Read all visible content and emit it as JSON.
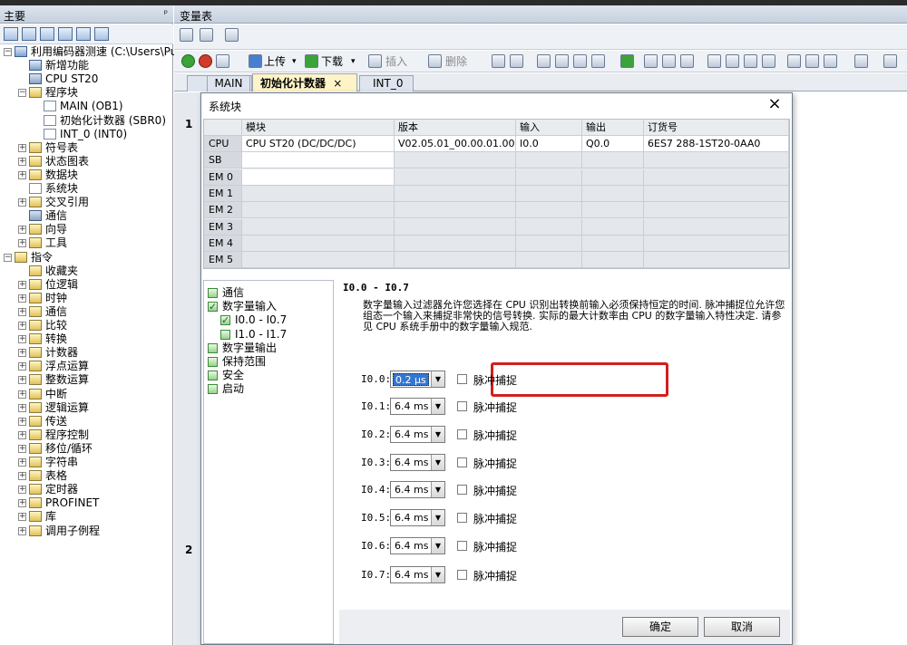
{
  "left_panel": {
    "title": "主要",
    "pin": "ᵖ",
    "tree": [
      {
        "label": "利用编码器测速 (C:\\Users\\Publi",
        "indent": 0,
        "exp": "-",
        "icon": "project"
      },
      {
        "label": "新增功能",
        "indent": 1,
        "icon": "help"
      },
      {
        "label": "CPU ST20",
        "indent": 1,
        "icon": "cpu"
      },
      {
        "label": "程序块",
        "indent": 1,
        "exp": "-",
        "icon": "folder"
      },
      {
        "label": "MAIN (OB1)",
        "indent": 2,
        "icon": "doc"
      },
      {
        "label": "初始化计数器 (SBR0)",
        "indent": 2,
        "icon": "doc"
      },
      {
        "label": "INT_0 (INT0)",
        "indent": 2,
        "icon": "doc"
      },
      {
        "label": "符号表",
        "indent": 1,
        "exp": "+",
        "icon": "folder"
      },
      {
        "label": "状态图表",
        "indent": 1,
        "exp": "+",
        "icon": "folder"
      },
      {
        "label": "数据块",
        "indent": 1,
        "exp": "+",
        "icon": "folder"
      },
      {
        "label": "系统块",
        "indent": 1,
        "icon": "doc"
      },
      {
        "label": "交叉引用",
        "indent": 1,
        "exp": "+",
        "icon": "folder"
      },
      {
        "label": "通信",
        "indent": 1,
        "icon": "cpu"
      },
      {
        "label": "向导",
        "indent": 1,
        "exp": "+",
        "icon": "folder"
      },
      {
        "label": "工具",
        "indent": 1,
        "exp": "+",
        "icon": "folder"
      },
      {
        "label": "指令",
        "indent": 0,
        "exp": "-",
        "icon": "folder"
      },
      {
        "label": "收藏夹",
        "indent": 1,
        "icon": "folder"
      },
      {
        "label": "位逻辑",
        "indent": 1,
        "exp": "+",
        "icon": "folder"
      },
      {
        "label": "时钟",
        "indent": 1,
        "exp": "+",
        "icon": "folder"
      },
      {
        "label": "通信",
        "indent": 1,
        "exp": "+",
        "icon": "folder"
      },
      {
        "label": "比较",
        "indent": 1,
        "exp": "+",
        "icon": "folder"
      },
      {
        "label": "转换",
        "indent": 1,
        "exp": "+",
        "icon": "folder"
      },
      {
        "label": "计数器",
        "indent": 1,
        "exp": "+",
        "icon": "folder"
      },
      {
        "label": "浮点运算",
        "indent": 1,
        "exp": "+",
        "icon": "folder"
      },
      {
        "label": "整数运算",
        "indent": 1,
        "exp": "+",
        "icon": "folder"
      },
      {
        "label": "中断",
        "indent": 1,
        "exp": "+",
        "icon": "folder"
      },
      {
        "label": "逻辑运算",
        "indent": 1,
        "exp": "+",
        "icon": "folder"
      },
      {
        "label": "传送",
        "indent": 1,
        "exp": "+",
        "icon": "folder"
      },
      {
        "label": "程序控制",
        "indent": 1,
        "exp": "+",
        "icon": "folder"
      },
      {
        "label": "移位/循环",
        "indent": 1,
        "exp": "+",
        "icon": "folder"
      },
      {
        "label": "字符串",
        "indent": 1,
        "exp": "+",
        "icon": "folder"
      },
      {
        "label": "表格",
        "indent": 1,
        "exp": "+",
        "icon": "folder"
      },
      {
        "label": "定时器",
        "indent": 1,
        "exp": "+",
        "icon": "folder"
      },
      {
        "label": "PROFINET",
        "indent": 1,
        "exp": "+",
        "icon": "folder"
      },
      {
        "label": "库",
        "indent": 1,
        "exp": "+",
        "icon": "folder"
      },
      {
        "label": "调用子例程",
        "indent": 1,
        "exp": "+",
        "icon": "folder"
      }
    ]
  },
  "right": {
    "title": "变量表",
    "toolbar": {
      "upload": "上传",
      "download": "下载",
      "insert": "插入",
      "delete": "删除"
    },
    "tabs": [
      "MAIN",
      "初始化计数器",
      "INT_0"
    ],
    "active_tab_close": "×",
    "network_numbers": [
      "1",
      "2"
    ]
  },
  "dialog": {
    "title": "系统块",
    "close": "×",
    "headers": [
      "模块",
      "版本",
      "输入",
      "输出",
      "订货号"
    ],
    "rows": [
      {
        "slot": "CPU",
        "module": "CPU ST20 (DC/DC/DC)",
        "version": "V02.05.01_00.00.01.00",
        "input": "I0.0",
        "output": "Q0.0",
        "order": "6ES7 288-1ST20-0AA0"
      },
      {
        "slot": "SB",
        "module": "",
        "version": "",
        "input": "",
        "output": "",
        "order": ""
      },
      {
        "slot": "EM 0",
        "module": "",
        "version": "",
        "input": "",
        "output": "",
        "order": ""
      },
      {
        "slot": "EM 1",
        "module": "",
        "version": "",
        "input": "",
        "output": "",
        "order": ""
      },
      {
        "slot": "EM 2",
        "module": "",
        "version": "",
        "input": "",
        "output": "",
        "order": ""
      },
      {
        "slot": "EM 3",
        "module": "",
        "version": "",
        "input": "",
        "output": "",
        "order": ""
      },
      {
        "slot": "EM 4",
        "module": "",
        "version": "",
        "input": "",
        "output": "",
        "order": ""
      },
      {
        "slot": "EM 5",
        "module": "",
        "version": "",
        "input": "",
        "output": "",
        "order": ""
      }
    ],
    "nav": [
      {
        "label": "通信",
        "checked": false,
        "indent": 0
      },
      {
        "label": "数字量输入",
        "checked": true,
        "indent": 0
      },
      {
        "label": "I0.0 - I0.7",
        "checked": true,
        "indent": 1
      },
      {
        "label": "I1.0 - I1.7",
        "checked": false,
        "indent": 1
      },
      {
        "label": "数字量输出",
        "checked": false,
        "indent": 0
      },
      {
        "label": "保持范围",
        "checked": false,
        "indent": 0
      },
      {
        "label": "安全",
        "checked": false,
        "indent": 0
      },
      {
        "label": "启动",
        "checked": false,
        "indent": 0
      }
    ],
    "section_title": "I0.0 - I0.7",
    "description": "数字量输入过滤器允许您选择在 CPU 识别出转换前输入必须保持恒定的时间. 脉冲捕捉位允许您组态一个输入来捕捉非常快的信号转换. 实际的最大计数率由 CPU 的数字量输入特性决定. 请参见 CPU 系统手册中的数字量输入规范.",
    "inputs": [
      {
        "label": "I0.0:",
        "value": "0.2 µs",
        "pulse": "脉冲捕捉"
      },
      {
        "label": "I0.1:",
        "value": "6.4 ms",
        "pulse": "脉冲捕捉"
      },
      {
        "label": "I0.2:",
        "value": "6.4 ms",
        "pulse": "脉冲捕捉"
      },
      {
        "label": "I0.3:",
        "value": "6.4 ms",
        "pulse": "脉冲捕捉"
      },
      {
        "label": "I0.4:",
        "value": "6.4 ms",
        "pulse": "脉冲捕捉"
      },
      {
        "label": "I0.5:",
        "value": "6.4 ms",
        "pulse": "脉冲捕捉"
      },
      {
        "label": "I0.6:",
        "value": "6.4 ms",
        "pulse": "脉冲捕捉"
      },
      {
        "label": "I0.7:",
        "value": "6.4 ms",
        "pulse": "脉冲捕捉"
      }
    ],
    "ok": "确定",
    "cancel": "取消"
  }
}
